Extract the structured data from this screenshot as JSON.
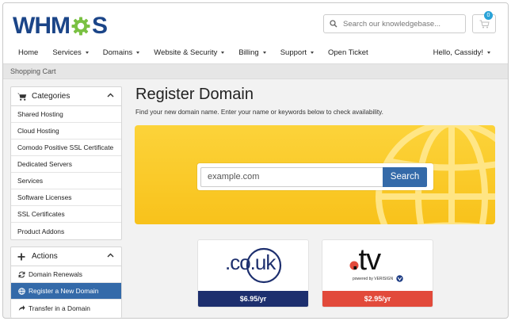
{
  "header": {
    "logo_text_1": "WHM",
    "logo_text_2": "S",
    "search_placeholder": "Search our knowledgebase...",
    "cart_count": "0",
    "colors": {
      "brand": "#1b4588",
      "gear": "#7ac143"
    }
  },
  "nav": {
    "items": [
      {
        "label": "Home",
        "dropdown": false
      },
      {
        "label": "Services",
        "dropdown": true
      },
      {
        "label": "Domains",
        "dropdown": true
      },
      {
        "label": "Website & Security",
        "dropdown": true
      },
      {
        "label": "Billing",
        "dropdown": true
      },
      {
        "label": "Support",
        "dropdown": true
      },
      {
        "label": "Open Ticket",
        "dropdown": false
      }
    ],
    "user_greeting": "Hello, Cassidy!"
  },
  "breadcrumb": "Shopping Cart",
  "sidebar": {
    "categories": {
      "title": "Categories",
      "items": [
        "Shared Hosting",
        "Cloud Hosting",
        "Comodo Positive SSL Certificate",
        "Dedicated Servers",
        "Services",
        "Software Licenses",
        "SSL Certificates",
        "Product Addons"
      ]
    },
    "actions": {
      "title": "Actions",
      "items": [
        {
          "label": "Domain Renewals",
          "icon": "refresh-icon",
          "active": false
        },
        {
          "label": "Register a New Domain",
          "icon": "globe-icon",
          "active": true
        },
        {
          "label": "Transfer in a Domain",
          "icon": "share-icon",
          "active": false
        }
      ]
    }
  },
  "main": {
    "title": "Register Domain",
    "subtitle": "Find your new domain name. Enter your name or keywords below to check availability.",
    "search_placeholder": "example.com",
    "search_button": "Search",
    "tlds": [
      {
        "name": ".co.uk",
        "price": "$6.95/yr",
        "color": "#1d2f6e"
      },
      {
        "name": ".tv",
        "tagline": "powered by VERISIGN",
        "price": "$2.95/yr",
        "color": "#e24a3b"
      }
    ]
  }
}
